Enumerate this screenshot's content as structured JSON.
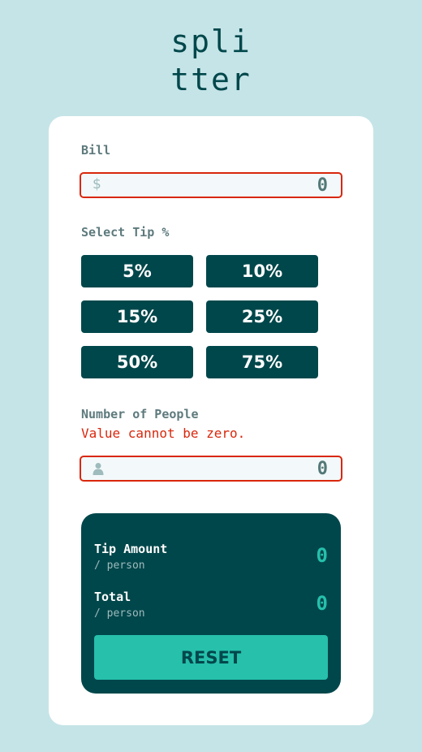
{
  "logo": {
    "line1": "spli",
    "line2": "tter"
  },
  "bill": {
    "label": "Bill",
    "icon": "dollar-icon",
    "icon_glyph": "$",
    "placeholder": "0"
  },
  "tip": {
    "label": "Select Tip %",
    "options": [
      "5%",
      "10%",
      "15%",
      "25%",
      "50%",
      "75%"
    ]
  },
  "people": {
    "label": "Number of People",
    "error": "Value cannot be zero.",
    "icon": "person-icon",
    "placeholder": "0"
  },
  "results": {
    "tip_amount": {
      "label": "Tip Amount",
      "sub": "/ person",
      "value": "0"
    },
    "total": {
      "label": "Total",
      "sub": "/ person",
      "value": "0"
    },
    "reset_label": "RESET"
  },
  "colors": {
    "background": "#c5e4e7",
    "dark_cyan": "#00474b",
    "strong_cyan": "#26c0ab",
    "error": "#d9270c"
  }
}
